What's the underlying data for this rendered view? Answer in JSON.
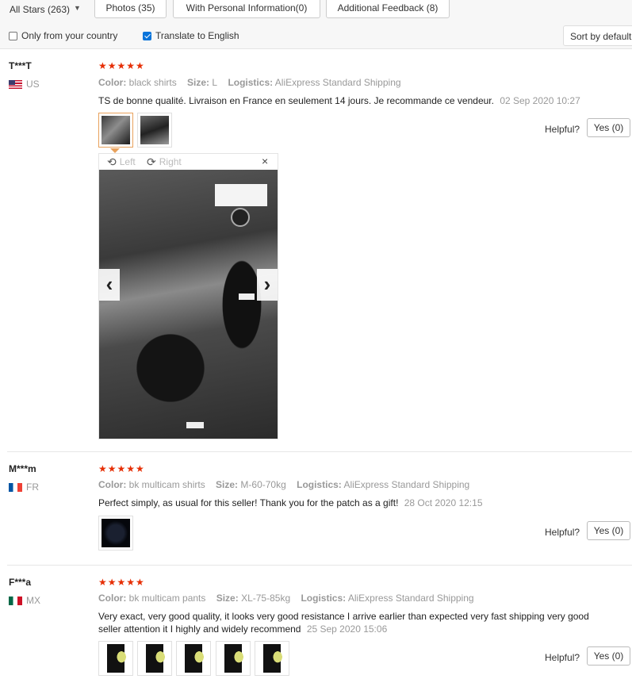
{
  "filters": {
    "all_stars": "All Stars (263)",
    "photos": "Photos (35)",
    "with_personal": "With Personal Information(0)",
    "additional": "Additional Feedback (8)",
    "only_country": "Only from your country",
    "translate": "Translate to English",
    "translate_checked": true,
    "only_country_checked": false,
    "sort_by": "Sort by default"
  },
  "labels": {
    "color": "Color:",
    "size": "Size:",
    "logistics": "Logistics:",
    "helpful": "Helpful?",
    "stars": "★★★★★"
  },
  "viewer": {
    "left": "Left",
    "right": "Right",
    "close": "×",
    "prev": "‹",
    "next": "›"
  },
  "reviews": [
    {
      "user": "T***T",
      "country": "US",
      "color": "black shirts",
      "size": "L",
      "logistics": "AliExpress Standard Shipping",
      "text": "TS de bonne qualité. Livraison en France en seulement 14 jours. Je recommande ce vendeur.",
      "date": "02 Sep 2020 10:27",
      "yes": "Yes (0)",
      "rating": 5
    },
    {
      "user": "M***m",
      "country": "FR",
      "color": "bk multicam shirts",
      "size": "M-60-70kg",
      "logistics": "AliExpress Standard Shipping",
      "text": "Perfect simply, as usual for this seller! Thank you for the patch as a gift!",
      "date": "28 Oct 2020 12:15",
      "yes": "Yes (0)",
      "rating": 5
    },
    {
      "user": "F***a",
      "country": "MX",
      "color": "bk multicam pants",
      "size": "XL-75-85kg",
      "logistics": "AliExpress Standard Shipping",
      "text": "Very exact, very good quality, it looks very good resistance I arrive earlier than expected very fast shipping very good seller attention it I highly and widely recommend",
      "date": "25 Sep 2020 15:06",
      "yes": "Yes (0)",
      "rating": 5
    }
  ],
  "icons": {
    "rotate_left": "rotate-left-icon",
    "rotate_right": "rotate-right-icon"
  }
}
